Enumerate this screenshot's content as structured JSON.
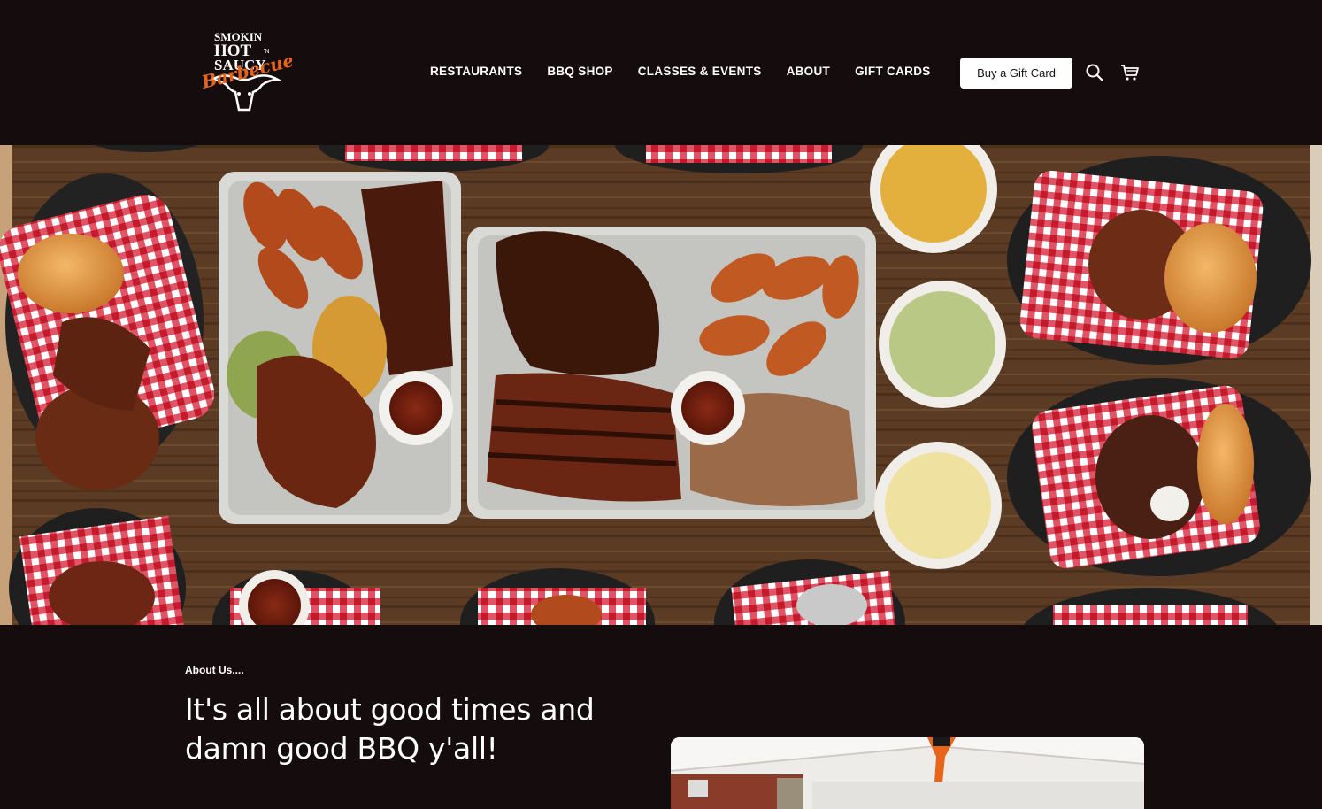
{
  "header": {
    "logo": {
      "line1": "SMOKIN",
      "line2": "HOT",
      "line2b": "'N",
      "line3": "SAUCY",
      "script": "Barbecue"
    },
    "nav": [
      {
        "label": "RESTAURANTS"
      },
      {
        "label": "BBQ SHOP"
      },
      {
        "label": "CLASSES & EVENTS"
      },
      {
        "label": "ABOUT"
      },
      {
        "label": "GIFT CARDS"
      }
    ],
    "gift_button": "Buy a Gift Card",
    "icons": {
      "search": "search-icon",
      "cart": "cart-icon"
    }
  },
  "about": {
    "kicker": "About Us....",
    "heading": "It's all about good times and damn good BBQ y'all!"
  },
  "colors": {
    "background": "#140c0d",
    "logo_orange": "#e8641a",
    "button_bg": "#ffffff",
    "table_wood": "#5a3a22",
    "gingham_red": "#d7283a"
  }
}
